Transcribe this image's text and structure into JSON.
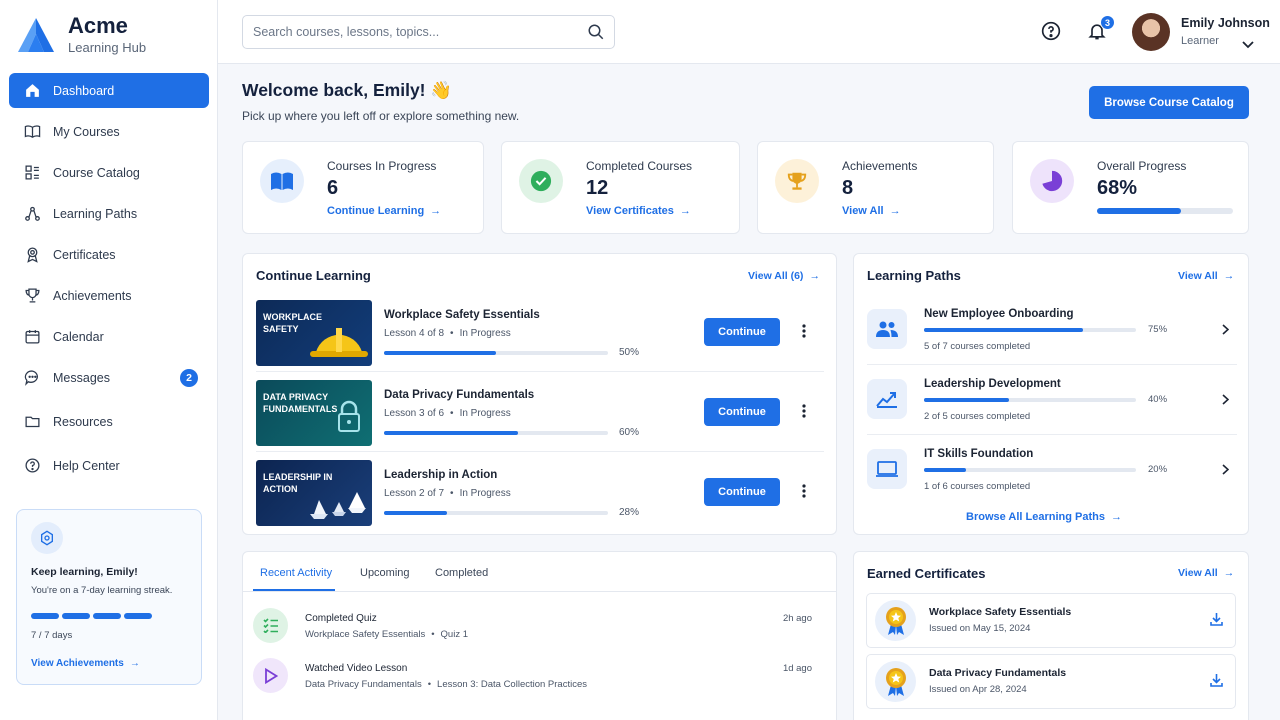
{
  "brand": {
    "name": "Acme",
    "subtitle": "Learning Hub"
  },
  "nav": [
    {
      "label": "Dashboard",
      "icon": "home-icon",
      "active": true
    },
    {
      "label": "My Courses",
      "icon": "book-icon"
    },
    {
      "label": "Course Catalog",
      "icon": "catalog-icon"
    },
    {
      "label": "Learning Paths",
      "icon": "path-icon"
    },
    {
      "label": "Certificates",
      "icon": "certificate-icon"
    },
    {
      "label": "Achievements",
      "icon": "trophy-icon"
    },
    {
      "label": "Calendar",
      "icon": "calendar-icon"
    },
    {
      "label": "Messages",
      "icon": "chat-icon",
      "badge": "2"
    },
    {
      "label": "Resources",
      "icon": "folder-icon"
    },
    {
      "label": "Help Center",
      "icon": "help-icon"
    }
  ],
  "streak": {
    "title": "Keep learning, Emily!",
    "text": "You're on a 7-day learning streak.",
    "days": "7 / 7 days",
    "link": "View Achievements"
  },
  "search": {
    "placeholder": "Search courses, lessons, topics..."
  },
  "header": {
    "notifications": "3",
    "user_name": "Emily Johnson",
    "user_role": "Learner"
  },
  "welcome": {
    "title": "Welcome back, Emily! 👋",
    "subtitle": "Pick up where you left off or explore something new.",
    "browse_button": "Browse Course Catalog"
  },
  "stats": [
    {
      "label": "Courses In Progress",
      "value": "6",
      "link": "Continue Learning",
      "color": "#1f6fe5"
    },
    {
      "label": "Completed Courses",
      "value": "12",
      "link": "View Certificates",
      "color": "#2fae5c"
    },
    {
      "label": "Achievements",
      "value": "8",
      "link": "View All",
      "color": "#e5a11c"
    },
    {
      "label": "Overall Progress",
      "value": "68%",
      "progress": 0.62,
      "color": "#7a3fd6"
    }
  ],
  "continue_learning": {
    "title": "Continue Learning",
    "link": "View All (6)",
    "button_label": "Continue",
    "courses": [
      {
        "thumb_text": "WORKPLACE SAFETY",
        "name": "Workplace Safety Essentials",
        "lesson": "Lesson 4 of 8",
        "status": "In Progress",
        "progress": 0.5,
        "pct": "50%"
      },
      {
        "thumb_text": "DATA PRIVACY FUNDAMENTALS",
        "name": "Data Privacy Fundamentals",
        "lesson": "Lesson 3 of 6",
        "status": "In Progress",
        "progress": 0.6,
        "pct": "60%"
      },
      {
        "thumb_text": "LEADERSHIP IN ACTION",
        "name": "Leadership in Action",
        "lesson": "Lesson 2 of 7",
        "status": "In Progress",
        "progress": 0.28,
        "pct": "28%"
      }
    ]
  },
  "learning_paths": {
    "title": "Learning Paths",
    "link": "View All",
    "browse": "Browse All Learning Paths",
    "paths": [
      {
        "name": "New Employee Onboarding",
        "sub": "5 of 7 courses completed",
        "progress": 0.75,
        "pct": "75%",
        "icon": "users-icon"
      },
      {
        "name": "Leadership Development",
        "sub": "2 of 5 courses completed",
        "progress": 0.4,
        "pct": "40%",
        "icon": "chart-up-icon"
      },
      {
        "name": "IT Skills Foundation",
        "sub": "1 of 6 courses completed",
        "progress": 0.2,
        "pct": "20%",
        "icon": "laptop-icon"
      }
    ]
  },
  "activity": {
    "tabs": [
      "Recent Activity",
      "Upcoming",
      "Completed"
    ],
    "items": [
      {
        "title": "Completed Quiz",
        "course": "Workplace Safety Essentials",
        "detail": "Quiz 1",
        "time": "2h ago",
        "icon": "checklist-icon"
      },
      {
        "title": "Watched Video Lesson",
        "course": "Data Privacy Fundamentals",
        "detail": "Lesson 3: Data Collection Practices",
        "time": "1d ago",
        "icon": "play-icon"
      }
    ]
  },
  "certificates": {
    "title": "Earned Certificates",
    "link": "View All",
    "items": [
      {
        "name": "Workplace Safety Essentials",
        "date": "Issued on May 15, 2024"
      },
      {
        "name": "Data Privacy Fundamentals",
        "date": "Issued on Apr 28, 2024"
      }
    ]
  }
}
